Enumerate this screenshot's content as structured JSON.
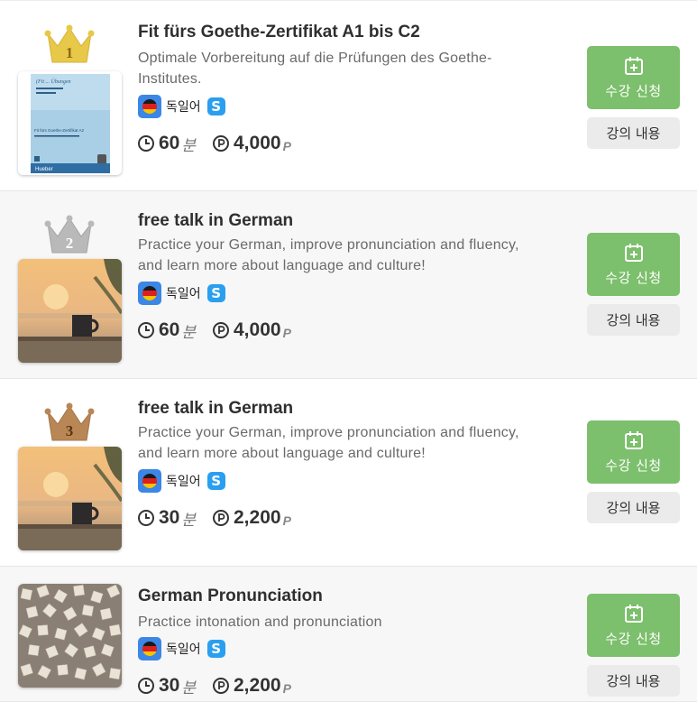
{
  "courses": [
    {
      "rank": "1",
      "crown_color": "#e8c848",
      "thumb": "book-cover",
      "title": "Fit fürs Goethe-Zertifikat A1 bis C2",
      "desc_line1": "Optimale Vorbereitung auf die Prüfungen des Goethe-",
      "desc_line2": "Institutes.",
      "language": "독일어",
      "skype": "S",
      "duration": "60",
      "duration_unit": "분",
      "price": "4,000",
      "price_unit": "P",
      "enroll_label": "수강 신청",
      "detail_label": "강의 내용"
    },
    {
      "rank": "2",
      "crown_color": "#b9b9b9",
      "thumb": "sunset-photo",
      "title": "free talk in German",
      "desc_line1": "Practice your German, improve pronunciation and fluency,",
      "desc_line2": "and learn more about language and culture!",
      "language": "독일어",
      "skype": "S",
      "duration": "60",
      "duration_unit": "분",
      "price": "4,000",
      "price_unit": "P",
      "enroll_label": "수강 신청",
      "detail_label": "강의 내용"
    },
    {
      "rank": "3",
      "crown_color": "#b98756",
      "thumb": "sunset-photo",
      "title": "free talk in German",
      "desc_line1": "Practice your German, improve pronunciation and fluency,",
      "desc_line2": "and learn more about language and culture!",
      "language": "독일어",
      "skype": "S",
      "duration": "30",
      "duration_unit": "분",
      "price": "2,200",
      "price_unit": "P",
      "enroll_label": "수강 신청",
      "detail_label": "강의 내용"
    },
    {
      "thumb": "letter-tiles-photo",
      "title": "German Pronunciation",
      "desc_line1": "Practice intonation and pronunciation",
      "desc_line2": "",
      "language": "독일어",
      "skype": "S",
      "duration": "30",
      "duration_unit": "분",
      "price": "2,200",
      "price_unit": "P",
      "enroll_label": "수강 신청",
      "detail_label": "강의 내용"
    }
  ],
  "colors": {
    "enroll_green": "#7cbf6c",
    "detail_gray": "#ebebeb",
    "flag_bg": "#3c86e6",
    "skype_blue": "#2a9ff0"
  },
  "book_cover": {
    "series": "Fit fürs Goethe-Zertifikat A2",
    "publisher": "Hueber"
  }
}
